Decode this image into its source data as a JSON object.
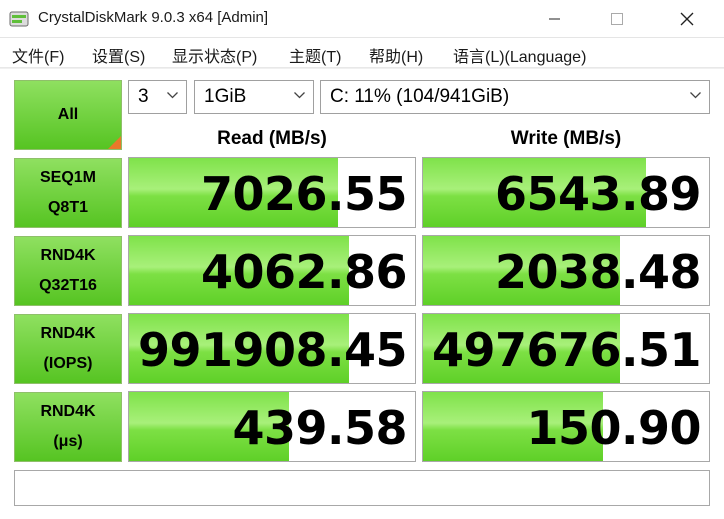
{
  "window": {
    "title": "CrystalDiskMark 9.0.3 x64 [Admin]",
    "minimize_icon": "minimize-icon",
    "maximize_icon": "maximize-icon",
    "close_icon": "close-icon"
  },
  "menu": [
    {
      "label": "文件(F)"
    },
    {
      "label": "设置(S)"
    },
    {
      "label": "显示状态(P)"
    },
    {
      "label": "主题(T)"
    },
    {
      "label": "帮助(H)"
    },
    {
      "label": "语言(L)(Language)"
    }
  ],
  "controls": {
    "all_label": "All",
    "count_value": "3",
    "size_value": "1GiB",
    "drive_value": "C: 11% (104/941GiB)"
  },
  "headers": {
    "read": "Read (MB/s)",
    "write": "Write (MB/s)"
  },
  "tests": [
    {
      "line1": "SEQ1M",
      "line2": "Q8T1",
      "read": "7026.55",
      "write": "6543.89",
      "read_fill": 0.73,
      "write_fill": 0.78
    },
    {
      "line1": "RND4K",
      "line2": "Q32T16",
      "read": "4062.86",
      "write": "2038.48",
      "read_fill": 0.77,
      "write_fill": 0.69
    },
    {
      "line1": "RND4K",
      "line2": "(IOPS)",
      "read": "991908.45",
      "write": "497676.51",
      "read_fill": 0.77,
      "write_fill": 0.69
    },
    {
      "line1": "RND4K",
      "line2": "(μs)",
      "read": "439.58",
      "write": "150.90",
      "read_fill": 0.56,
      "write_fill": 0.63
    }
  ],
  "status_text": "",
  "colors": {
    "accent_green": "#56c422",
    "fill_green": "#7fe24a",
    "corner_orange": "#e8792a"
  }
}
